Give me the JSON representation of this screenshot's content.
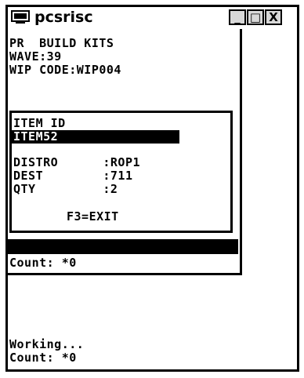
{
  "window": {
    "title": "pcsrisc",
    "min_glyph": "_",
    "max_glyph": "□",
    "close_glyph": "X"
  },
  "header": {
    "line1": "PR  BUILD KITS",
    "line2": "WAVE:39",
    "line3": "WIP CODE:WIP004"
  },
  "dialog": {
    "item_id_label": "ITEM ID",
    "item_id_value": "ITEM52",
    "distro": "DISTRO      :ROP1",
    "dest": "DEST        :711",
    "qty": "QTY         :2",
    "exit": "F3=EXIT"
  },
  "status": {
    "count_upper": "Count: *0",
    "working": "Working...",
    "count_lower": "Count: *0"
  }
}
